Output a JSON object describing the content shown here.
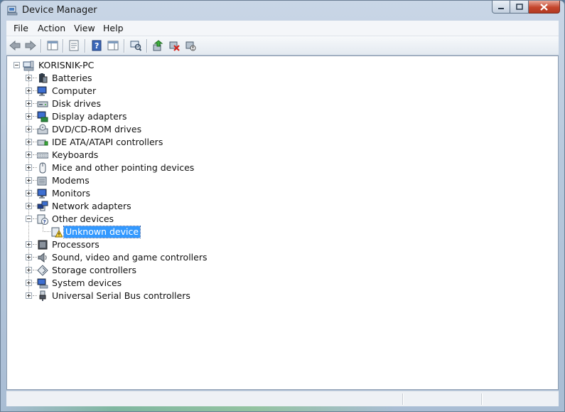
{
  "window": {
    "title": "Device Manager"
  },
  "menu": {
    "items": [
      {
        "label": "File"
      },
      {
        "label": "Action"
      },
      {
        "label": "View"
      },
      {
        "label": "Help"
      }
    ]
  },
  "toolbar": {
    "buttons": [
      {
        "icon": "back-arrow-icon"
      },
      {
        "icon": "forward-arrow-icon"
      },
      {
        "icon": "show-hide-console-tree-icon"
      },
      {
        "icon": "properties-icon"
      },
      {
        "icon": "help-icon"
      },
      {
        "icon": "action-pane-icon"
      },
      {
        "icon": "scan-hardware-changes-icon"
      },
      {
        "icon": "update-driver-icon"
      },
      {
        "icon": "uninstall-device-icon"
      },
      {
        "icon": "disable-device-icon"
      }
    ]
  },
  "tree": {
    "root": {
      "label": "KORISNIK-PC",
      "icon": "computer-icon"
    },
    "categories": [
      {
        "label": "Batteries",
        "icon": "battery-icon"
      },
      {
        "label": "Computer",
        "icon": "monitor-icon"
      },
      {
        "label": "Disk drives",
        "icon": "disk-drive-icon"
      },
      {
        "label": "Display adapters",
        "icon": "display-adapter-icon"
      },
      {
        "label": "DVD/CD-ROM drives",
        "icon": "dvd-drive-icon"
      },
      {
        "label": "IDE ATA/ATAPI controllers",
        "icon": "ide-controller-icon"
      },
      {
        "label": "Keyboards",
        "icon": "keyboard-icon"
      },
      {
        "label": "Mice and other pointing devices",
        "icon": "mouse-icon"
      },
      {
        "label": "Modems",
        "icon": "modem-icon"
      },
      {
        "label": "Monitors",
        "icon": "monitor-icon"
      },
      {
        "label": "Network adapters",
        "icon": "network-adapter-icon"
      },
      {
        "label": "Other devices",
        "icon": "other-devices-icon",
        "expanded": true,
        "children": [
          {
            "label": "Unknown device",
            "icon": "warning-device-icon",
            "selected": true
          }
        ]
      },
      {
        "label": "Processors",
        "icon": "processor-icon"
      },
      {
        "label": "Sound, video and game controllers",
        "icon": "speaker-icon"
      },
      {
        "label": "Storage controllers",
        "icon": "storage-controller-icon"
      },
      {
        "label": "System devices",
        "icon": "system-devices-icon"
      },
      {
        "label": "Universal Serial Bus controllers",
        "icon": "usb-icon"
      }
    ]
  },
  "colors": {
    "selection": "#3399ff",
    "frame": "#b7c8dc"
  }
}
